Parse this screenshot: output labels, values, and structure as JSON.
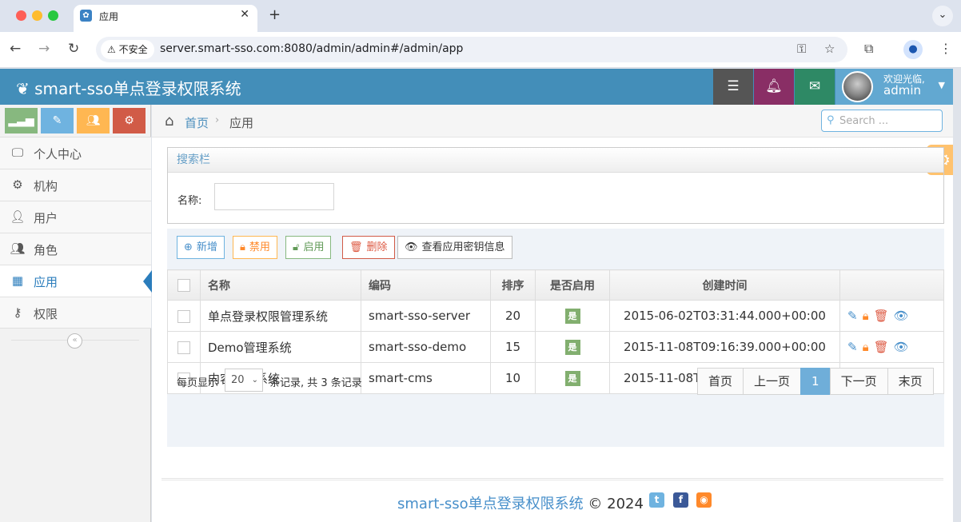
{
  "browser": {
    "tab_title": "应用",
    "tab_close": "✕",
    "new_tab": "+",
    "tab_menu": "⌄",
    "security_label": "不安全",
    "url": "server.smart-sso.com:8080/admin/admin#/admin/app"
  },
  "header": {
    "brand": "smart-sso单点登录权限系统",
    "welcome": "欢迎光临,",
    "username": "admin"
  },
  "sidebar": {
    "items": [
      {
        "label": "个人中心",
        "icon": "desktop-icon"
      },
      {
        "label": "机构",
        "icon": "gears-icon"
      },
      {
        "label": "用户",
        "icon": "user-icon"
      },
      {
        "label": "角色",
        "icon": "users-icon"
      },
      {
        "label": "应用",
        "icon": "grid-icon"
      },
      {
        "label": "权限",
        "icon": "key-icon"
      }
    ]
  },
  "breadcrumb": {
    "home": "首页",
    "current": "应用"
  },
  "search": {
    "placeholder": "Search ..."
  },
  "search_panel": {
    "title": "搜索栏",
    "name_label": "名称:"
  },
  "toolbar": {
    "add": "新增",
    "disable": "禁用",
    "enable": "启用",
    "delete": "删除",
    "view_key": "查看应用密钥信息"
  },
  "table": {
    "columns": [
      "名称",
      "编码",
      "排序",
      "是否启用",
      "创建时间"
    ],
    "rows": [
      {
        "name": "单点登录权限管理系统",
        "code": "smart-sso-server",
        "sort": "20",
        "enabled": "是",
        "created": "2015-06-02T03:31:44.000+00:00"
      },
      {
        "name": "Demo管理系统",
        "code": "smart-sso-demo",
        "sort": "15",
        "enabled": "是",
        "created": "2015-11-08T09:16:39.000+00:00"
      },
      {
        "name": "内容管理系统",
        "code": "smart-cms",
        "sort": "10",
        "enabled": "是",
        "created": "2015-11-08T09:16:39.000+00:00"
      }
    ]
  },
  "pager": {
    "per_page_label": "每页显示",
    "page_size": "20",
    "records_text": "条记录, 共 3 条记录",
    "first": "首页",
    "prev": "上一页",
    "current": "1",
    "next": "下一页",
    "last": "末页"
  },
  "footer": {
    "brand": "smart-sso单点登录权限系统",
    "copyright": "© 2024"
  },
  "colors": {
    "header": "#438eb9",
    "active": "#2b7dbc"
  }
}
